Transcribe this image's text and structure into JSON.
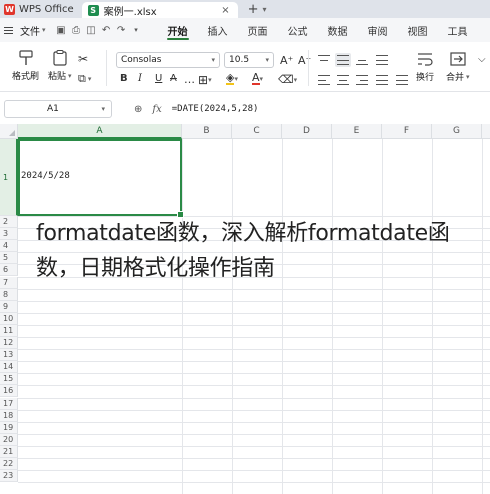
{
  "titlebar": {
    "app_name": "WPS Office",
    "file_tab": "案例一.xlsx",
    "close_glyph": "×",
    "new_tab_glyph": "+"
  },
  "menu": {
    "file_label": "文件",
    "tabs": [
      "开始",
      "插入",
      "页面",
      "公式",
      "数据",
      "审阅",
      "视图",
      "工具"
    ],
    "active_tab": "开始"
  },
  "ribbon": {
    "format_painter": "格式刷",
    "paste": "粘贴",
    "font_name": "Consolas",
    "font_size": "10.5",
    "wrap": "换行",
    "merge": "合并",
    "accent_color": "#2a7d3b",
    "font_color": "#e0352b",
    "fill_color": "#f2c318"
  },
  "formula_bar": {
    "cell_ref": "A1",
    "formula": "=DATE(2024,5,28)"
  },
  "sheet": {
    "columns": [
      "A",
      "B",
      "C",
      "D",
      "E",
      "F",
      "G"
    ],
    "rows": [
      "1",
      "2",
      "3",
      "4",
      "5",
      "6",
      "7",
      "8",
      "9",
      "10",
      "11",
      "12",
      "13",
      "14",
      "15",
      "16",
      "17",
      "18",
      "19",
      "20",
      "21",
      "22",
      "23"
    ],
    "selected_cell": "A1",
    "cell_a1": "2024/5/28"
  },
  "overlay_text": "formatdate函数，深入解析formatdate函数，日期格式化操作指南"
}
